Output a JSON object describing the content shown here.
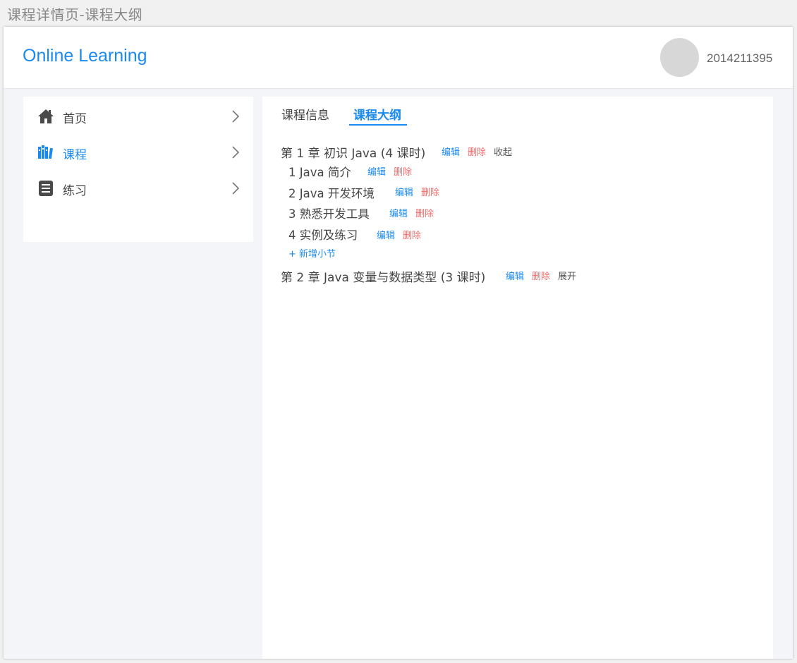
{
  "page_caption": "课程详情页-课程大纲",
  "header": {
    "logo": "Online Learning",
    "user_id": "2014211395"
  },
  "sidebar": {
    "items": [
      {
        "label": "首页",
        "icon": "home-icon",
        "active": false
      },
      {
        "label": "课程",
        "icon": "books-icon",
        "active": true
      },
      {
        "label": "练习",
        "icon": "list-icon",
        "active": false
      }
    ]
  },
  "tabs": [
    {
      "label": "课程信息",
      "active": false
    },
    {
      "label": "课程大纲",
      "active": true
    }
  ],
  "outline": {
    "chapters": [
      {
        "title": "第 1 章 初识 Java (4 课时)",
        "edit": "编辑",
        "delete": "删除",
        "toggle": "收起",
        "sections": [
          {
            "title": "1 Java 简介",
            "edit": "编辑",
            "delete": "删除"
          },
          {
            "title": "2 Java 开发环境",
            "edit": "编辑",
            "delete": "删除"
          },
          {
            "title": "3 熟悉开发工具",
            "edit": "编辑",
            "delete": "删除"
          },
          {
            "title": "4 实例及练习",
            "edit": "编辑",
            "delete": "删除"
          }
        ],
        "add_section": "+ 新增小节"
      },
      {
        "title": "第 2 章 Java 变量与数据类型 (3 课时)",
        "edit": "编辑",
        "delete": "删除",
        "toggle": "展开"
      }
    ]
  },
  "colors": {
    "accent": "#1a8af0",
    "danger": "#f56c6c",
    "background": "#f4f5f9"
  }
}
